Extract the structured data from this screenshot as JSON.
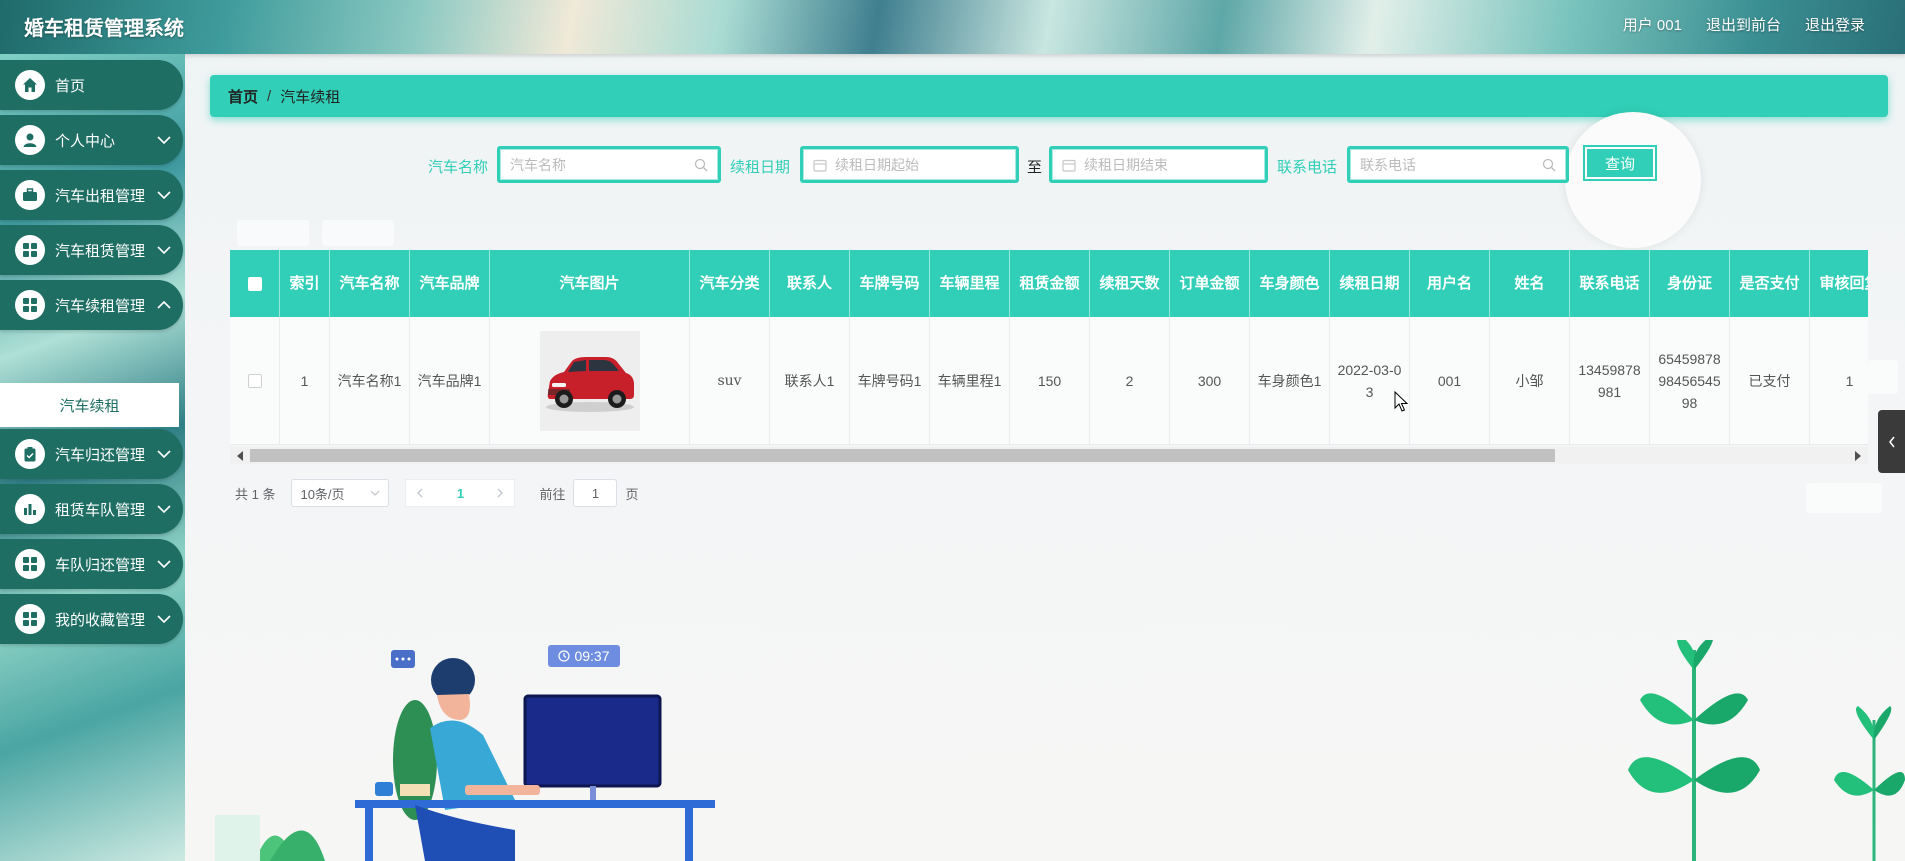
{
  "app": {
    "title": "婚车租赁管理系统"
  },
  "header": {
    "user": "用户 001",
    "to_front": "退出到前台",
    "logout": "退出登录"
  },
  "sidebar": {
    "items": [
      {
        "label": "首页",
        "icon": "home-icon"
      },
      {
        "label": "个人中心",
        "icon": "user-icon"
      },
      {
        "label": "汽车出租管理",
        "icon": "briefcase-icon"
      },
      {
        "label": "汽车租赁管理",
        "icon": "grid-icon"
      },
      {
        "label": "汽车续租管理",
        "icon": "grid-icon"
      },
      {
        "label": "汽车归还管理",
        "icon": "clipboard-icon"
      },
      {
        "label": "租赁车队管理",
        "icon": "bar-chart-icon"
      },
      {
        "label": "车队归还管理",
        "icon": "grid-icon"
      },
      {
        "label": "我的收藏管理",
        "icon": "grid-icon"
      }
    ],
    "active_sub": "汽车续租"
  },
  "breadcrumb": {
    "home": "首页",
    "sep": "/",
    "current": "汽车续租"
  },
  "search": {
    "car_name_label": "汽车名称",
    "car_name_placeholder": "汽车名称",
    "date_label": "续租日期",
    "date_start_placeholder": "续租日期起始",
    "to": "至",
    "date_end_placeholder": "续租日期结束",
    "phone_label": "联系电话",
    "phone_placeholder": "联系电话",
    "button": "查询"
  },
  "table": {
    "columns": [
      "索引",
      "汽车名称",
      "汽车品牌",
      "汽车图片",
      "汽车分类",
      "联系人",
      "车牌号码",
      "车辆里程",
      "租赁金额",
      "续租天数",
      "订单金额",
      "车身颜色",
      "续租日期",
      "用户名",
      "姓名",
      "联系电话",
      "身份证",
      "是否支付",
      "审核回复"
    ],
    "rows": [
      {
        "index": "1",
        "car_name": "汽车名称1",
        "brand": "汽车品牌1",
        "category": "suv",
        "contact": "联系人1",
        "plate": "车牌号码1",
        "mileage": "车辆里程1",
        "rent": "150",
        "days": "2",
        "amount": "300",
        "color": "车身颜色1",
        "date": "2022-03-03",
        "username": "001",
        "name": "小邹",
        "phone": "13459878981",
        "id_card": "654598789845654598",
        "paid": "已支付",
        "reply": "1"
      }
    ]
  },
  "pagination": {
    "total": "共 1 条",
    "page_size": "10条/页",
    "current": "1",
    "goto_label": "前往",
    "goto_value": "1",
    "page_unit": "页"
  },
  "illustration": {
    "time": "09:37"
  },
  "colors": {
    "accent": "#31cfb7",
    "sidebar": "#1e6e63"
  }
}
